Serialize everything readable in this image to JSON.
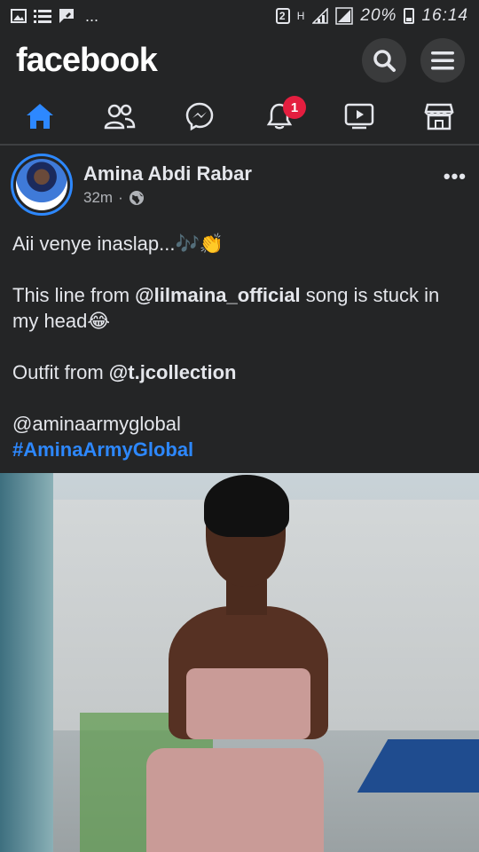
{
  "status_bar": {
    "left_icons": [
      "image-icon",
      "list-icon",
      "chat-icon"
    ],
    "overflow": "...",
    "sim_slot": "2",
    "network": "H",
    "battery_percent": "20%",
    "time": "16:14"
  },
  "header": {
    "logo": "facebook",
    "actions": [
      "search-icon",
      "menu-icon"
    ]
  },
  "nav": {
    "tabs": [
      {
        "name": "home-icon",
        "active": true
      },
      {
        "name": "friends-icon",
        "active": false
      },
      {
        "name": "messenger-icon",
        "active": false
      },
      {
        "name": "notifications-icon",
        "active": false,
        "badge": "1"
      },
      {
        "name": "watch-icon",
        "active": false
      },
      {
        "name": "marketplace-icon",
        "active": false
      }
    ]
  },
  "post": {
    "author": "Amina Abdi Rabar",
    "time": "32m",
    "separator": "·",
    "privacy_icon": "globe-icon",
    "more": "•••",
    "line1_text": "Aii venye inaslap...",
    "line1_emoji": "🎶👏",
    "line2_prefix": "This line from ",
    "line2_mention": "@lilmaina_official",
    "line2_suffix": " song is stuck in my head",
    "line2_emoji": "😂",
    "line3_prefix": "Outfit from ",
    "line3_mention": "@t.jcollection",
    "line4": "@aminaarmyglobal",
    "hashtag": "#AminaArmyGlobal"
  },
  "colors": {
    "background": "#242526",
    "accent": "#2d88ff",
    "badge": "#e41e3f"
  }
}
